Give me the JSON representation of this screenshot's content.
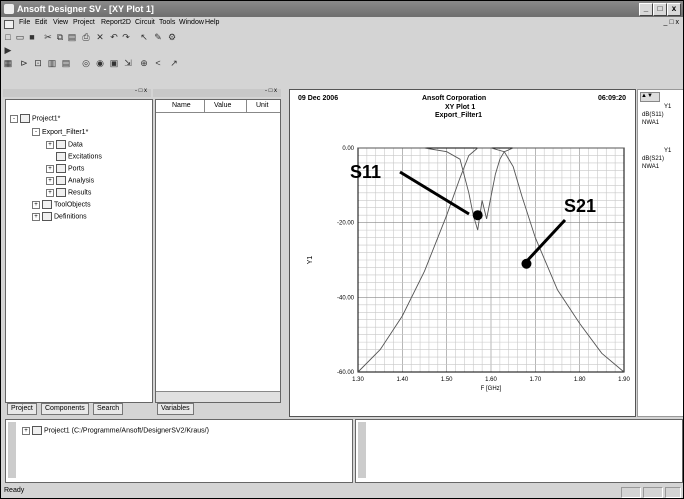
{
  "window": {
    "title": "Ansoft Designer SV - [XY Plot 1]"
  },
  "menu": [
    "File",
    "Edit",
    "View",
    "Project",
    "Report2D",
    "Circuit",
    "Tools",
    "Window",
    "Help"
  ],
  "project_tree": {
    "root": "Project1*",
    "design": "Export_Filter1*",
    "children": [
      "Data",
      "Excitations",
      "Ports",
      "Analysis",
      "Results"
    ],
    "siblings": [
      "ToolObjects",
      "Definitions"
    ]
  },
  "properties": {
    "columns": [
      "Name",
      "Value",
      "Unit"
    ]
  },
  "left_tabs": [
    "Project",
    "Components",
    "Search"
  ],
  "mid_tab": "Variables",
  "plot": {
    "date": "09 Dec 2006",
    "company": "Ansoft Corporation",
    "time": "06:09:20",
    "title": "XY Plot 1",
    "subtitle": "Export_Filter1",
    "ylabel": "Y1",
    "xlabel": "F [GHz]",
    "annotations": [
      "S11",
      "S21"
    ]
  },
  "chart_data": {
    "type": "line",
    "title": "XY Plot 1",
    "xlabel": "F [GHz]",
    "ylabel": "Y1",
    "xlim": [
      1.3,
      1.9
    ],
    "ylim": [
      -60,
      0
    ],
    "xticks": [
      "1.30",
      "1.40",
      "1.50",
      "1.60",
      "1.70",
      "1.80",
      "1.90"
    ],
    "yticks": [
      "0.00",
      "-20.00",
      "-40.00",
      "-60.00"
    ],
    "grid": true,
    "series": [
      {
        "name": "dB(S11)",
        "x": [
          1.3,
          1.45,
          1.5,
          1.53,
          1.55,
          1.56,
          1.57,
          1.58,
          1.59,
          1.6,
          1.61,
          1.62,
          1.63,
          1.65,
          1.7,
          1.9
        ],
        "y": [
          0,
          0,
          -1,
          -3,
          -12,
          -18,
          -22,
          -14,
          -19,
          -13,
          -7,
          -3,
          -1,
          0,
          0,
          0
        ]
      },
      {
        "name": "dB(S21)",
        "x": [
          1.3,
          1.35,
          1.4,
          1.45,
          1.5,
          1.53,
          1.55,
          1.57,
          1.6,
          1.63,
          1.65,
          1.67,
          1.7,
          1.75,
          1.8,
          1.85,
          1.9
        ],
        "y": [
          -60,
          -54,
          -45,
          -33,
          -18,
          -8,
          -2,
          0,
          0,
          -1,
          -5,
          -13,
          -24,
          -38,
          -47,
          -55,
          -60
        ]
      }
    ]
  },
  "legend_panel": {
    "entries": [
      {
        "label": "Y1",
        "trace": "dB(S11)",
        "setup": "NWA1"
      },
      {
        "label": "Y1",
        "trace": "dB(S21)",
        "setup": "NWA1"
      }
    ]
  },
  "message": {
    "path": "Project1 (C:/Programme/Ansoft/DesignerSV2/Kraus/)"
  },
  "status": {
    "text": "Ready"
  }
}
